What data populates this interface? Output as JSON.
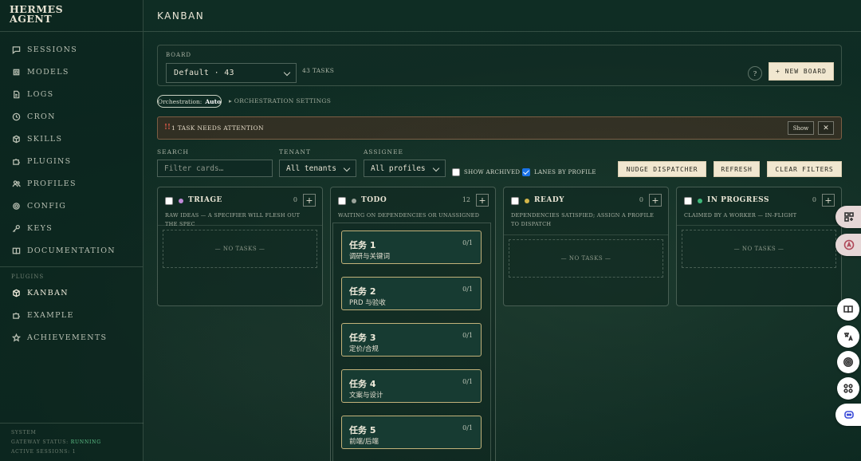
{
  "app": {
    "logo_line1": "HERMES",
    "logo_line2": "AGENT"
  },
  "sidebar": {
    "items": [
      {
        "label": "SESSIONS",
        "icon": "chat-icon"
      },
      {
        "label": "MODELS",
        "icon": "chip-icon"
      },
      {
        "label": "LOGS",
        "icon": "document-icon"
      },
      {
        "label": "CRON",
        "icon": "clock-icon"
      },
      {
        "label": "SKILLS",
        "icon": "box-icon"
      },
      {
        "label": "PLUGINS",
        "icon": "puzzle-icon"
      },
      {
        "label": "PROFILES",
        "icon": "users-icon"
      },
      {
        "label": "CONFIG",
        "icon": "gear-icon"
      },
      {
        "label": "KEYS",
        "icon": "key-icon"
      },
      {
        "label": "DOCUMENTATION",
        "icon": "book-icon"
      }
    ],
    "plugins_label": "PLUGINS",
    "plugin_items": [
      {
        "label": "KANBAN",
        "icon": "box-icon"
      },
      {
        "label": "EXAMPLE",
        "icon": "puzzle-icon"
      },
      {
        "label": "ACHIEVEMENTS",
        "icon": "star-icon"
      }
    ],
    "system": {
      "label": "SYSTEM",
      "gateway_label": "GATEWAY STATUS:",
      "gateway_value": "RUNNING",
      "sessions_label": "ACTIVE SESSIONS:",
      "sessions_value": "1"
    }
  },
  "header": {
    "title": "KANBAN"
  },
  "board": {
    "label": "BOARD",
    "selected": "Default · 43",
    "task_count": "43 TASKS",
    "help": "?",
    "new_board": "+ NEW BOARD"
  },
  "orchestration": {
    "label": "Orchestration:",
    "value": "Auto",
    "settings": "▸ ORCHESTRATION SETTINGS"
  },
  "attention": {
    "icon": "!!",
    "message": "1 TASK NEEDS ATTENTION",
    "show": "Show",
    "close": "✕"
  },
  "filters": {
    "search_label": "SEARCH",
    "search_placeholder": "Filter cards…",
    "tenant_label": "TENANT",
    "tenant_value": "All tenants",
    "assignee_label": "ASSIGNEE",
    "assignee_value": "All profiles",
    "show_archived": "SHOW ARCHIVED",
    "lanes_by_profile": "LANES BY PROFILE",
    "nudge": "NUDGE DISPATCHER",
    "refresh": "REFRESH",
    "clear": "CLEAR FILTERS"
  },
  "lanes": [
    {
      "title": "TRIAGE",
      "count": "0",
      "color": "#c08ad8",
      "desc": "RAW IDEAS — A SPECIFIER WILL FLESH OUT THE SPEC",
      "empty": "— NO TASKS —"
    },
    {
      "title": "TODO",
      "count": "12",
      "color": "#9aa39a",
      "desc": "WAITING ON DEPENDENCIES OR UNASSIGNED"
    },
    {
      "title": "READY",
      "count": "0",
      "color": "#d4b64a",
      "desc": "DEPENDENCIES SATISFIED; ASSIGN A PROFILE TO DISPATCH",
      "empty": "— NO TASKS —"
    },
    {
      "title": "IN PROGRESS",
      "count": "0",
      "color": "#3fb87a",
      "desc": "CLAIMED BY A WORKER — IN-FLIGHT",
      "empty": "— NO TASKS —"
    }
  ],
  "todo_cards": [
    {
      "title": "任务 1",
      "sub": "调研与关键词",
      "progress": "0/1"
    },
    {
      "title": "任务 2",
      "sub": "PRD 与验收",
      "progress": "0/1"
    },
    {
      "title": "任务 3",
      "sub": "定价/合规",
      "progress": "0/1"
    },
    {
      "title": "任务 4",
      "sub": "文案与设计",
      "progress": "0/1"
    },
    {
      "title": "任务 5",
      "sub": "前端/后端",
      "progress": "0/1"
    }
  ],
  "colors": {
    "accent_button": "#f1e7d0",
    "running": "#5fc48a",
    "card_border": "#c2b27a"
  }
}
